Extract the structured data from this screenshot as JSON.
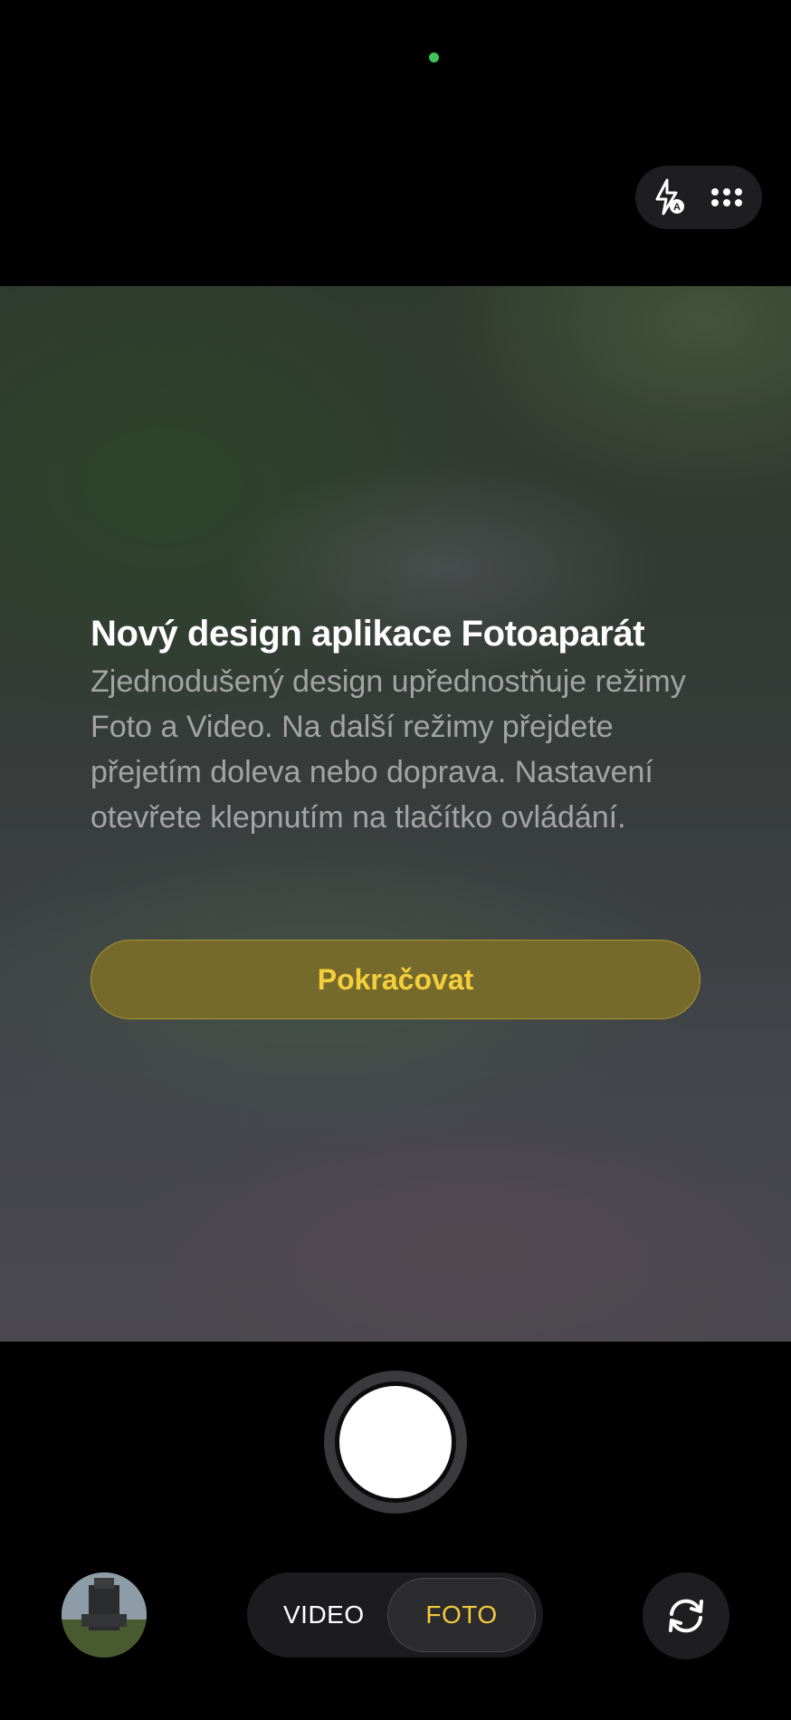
{
  "status": {
    "indicator_color": "#3fc45a"
  },
  "top_controls": {
    "flash_icon": "flash-auto-icon",
    "more_icon": "more-grid-icon"
  },
  "intro": {
    "title": "Nový design aplikace Fotoaparát",
    "body": "Zjednodušený design upřednostňuje režimy Foto a Video. Na další režimy přejdete přejetím doleva nebo doprava. Nastavení otevřete klepnutím na tlačítko ovládání.",
    "continue_label": "Pokračovat"
  },
  "bottom": {
    "shutter_icon": "shutter-button",
    "thumbnail": "last-photo-thumbnail",
    "modes": [
      {
        "label": "VIDEO",
        "active": false
      },
      {
        "label": "FOTO",
        "active": true
      }
    ],
    "flip_icon": "camera-flip-icon"
  },
  "colors": {
    "accent": "#f4cf3a",
    "button_fill": "#756a2c",
    "background": "#000000"
  }
}
